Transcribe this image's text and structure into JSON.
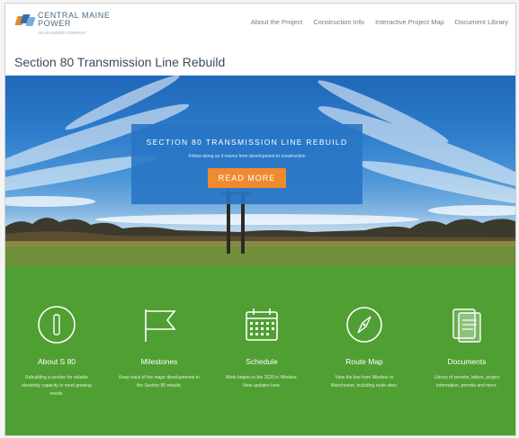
{
  "logo": {
    "line1": "CENTRAL MAINE",
    "line2": "POWER",
    "tagline": "AN AVANGRID COMPANY",
    "colors": [
      "#e0892e",
      "#2f6fb1",
      "#7aaed8"
    ]
  },
  "nav": [
    {
      "label": "About the Project"
    },
    {
      "label": "Construction Info"
    },
    {
      "label": "Interactive Project Map"
    },
    {
      "label": "Document Library"
    }
  ],
  "page_title": "Section 80 Transmission Line Rebuild",
  "hero": {
    "heading": "SECTION 80 TRANSMISSION LINE REBUILD",
    "subheading": "Follow along as it moves from development to construction",
    "button": "READ MORE"
  },
  "features": [
    {
      "icon": "info-icon",
      "label": "About S 80",
      "desc": "Rebuilding a section for reliable electricity capacity to meet growing needs."
    },
    {
      "icon": "flag-icon",
      "label": "Milestones",
      "desc": "Keep track of the major developments in the Section 80 rebuild."
    },
    {
      "icon": "calendar-icon",
      "label": "Schedule",
      "desc": "Work begins in the 2020 in Windsor. View updates here."
    },
    {
      "icon": "compass-icon",
      "label": "Route Map",
      "desc": "View the line from Windsor to Manchester, including route sites."
    },
    {
      "icon": "document-icon",
      "label": "Documents",
      "desc": "Library of permits, letters, project information, permits and more."
    }
  ],
  "colors": {
    "accent_orange": "#f08a2e",
    "hero_box": "#2876c4",
    "green": "#4f9f32",
    "title": "#3a4b5a"
  }
}
